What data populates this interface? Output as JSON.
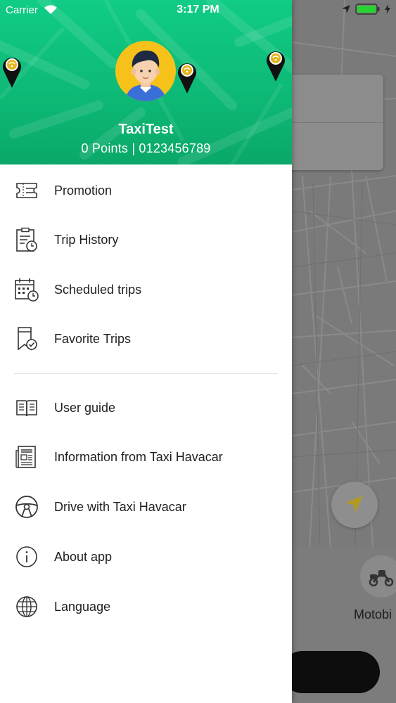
{
  "status_bar": {
    "carrier": "Carrier",
    "time": "3:17 PM"
  },
  "profile": {
    "name": "TaxiTest",
    "points_line": "0 Points | 0123456789"
  },
  "menu": {
    "group1": [
      {
        "label": "Promotion",
        "icon": "ticket-icon"
      },
      {
        "label": "Trip History",
        "icon": "clipboard-clock-icon"
      },
      {
        "label": "Scheduled trips",
        "icon": "calendar-clock-icon"
      },
      {
        "label": "Favorite Trips",
        "icon": "bookmark-check-icon"
      }
    ],
    "group2": [
      {
        "label": "User guide",
        "icon": "book-icon"
      },
      {
        "label": "Information from Taxi Havacar",
        "icon": "newspaper-icon"
      },
      {
        "label": "Drive with Taxi Havacar",
        "icon": "steering-wheel-icon"
      },
      {
        "label": "About app",
        "icon": "info-icon"
      },
      {
        "label": "Language",
        "icon": "globe-icon"
      }
    ]
  },
  "background": {
    "vehicle_label": "Motobi"
  },
  "colors": {
    "header_green": "#0db875",
    "drawer_bg": "#ffffff",
    "text": "#1f1f1f",
    "overlay_gray": "#7a7a7a",
    "locate_arrow": "#b29a22"
  }
}
